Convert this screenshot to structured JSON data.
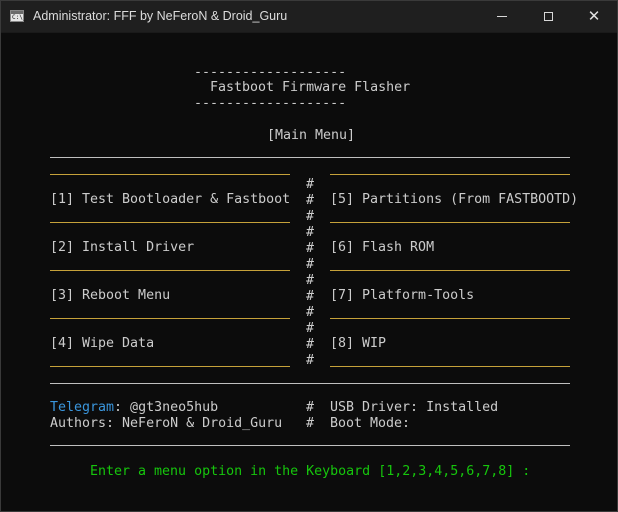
{
  "window": {
    "title": "Administrator:  FFF by NeFeroN & Droid_Guru",
    "icon": "terminal-icon",
    "icon_glyph": "C:\\_"
  },
  "console": {
    "banner_top": "-------------------",
    "banner_title": "Fastboot Firmware Flasher",
    "banner_bottom": "-------------------",
    "menu_heading": "[Main Menu]",
    "separator": "#",
    "left_items": [
      "[1] Test Bootloader & Fastboot",
      "[2] Install Driver",
      "[3] Reboot Menu",
      "[4] Wipe Data"
    ],
    "right_items": [
      "[5] Partitions (From FASTBOOTD)",
      "[6] Flash ROM",
      "[7] Platform-Tools",
      "[8] WIP"
    ],
    "telegram_label": "Telegram",
    "telegram_value": ": @gt3neo5hub",
    "authors": "Authors: NeFeroN & Droid_Guru",
    "usb_driver": "USB Driver: Installed",
    "boot_mode": "Boot Mode:",
    "prompt": "Enter a menu option in the Keyboard [1,2,3,4,5,6,7,8] :"
  },
  "colors": {
    "background": "#0c0c0c",
    "text": "#cccccc",
    "telegram": "#3a96dd",
    "prompt": "#16c60c",
    "menu_rules": "#c6a23a"
  }
}
